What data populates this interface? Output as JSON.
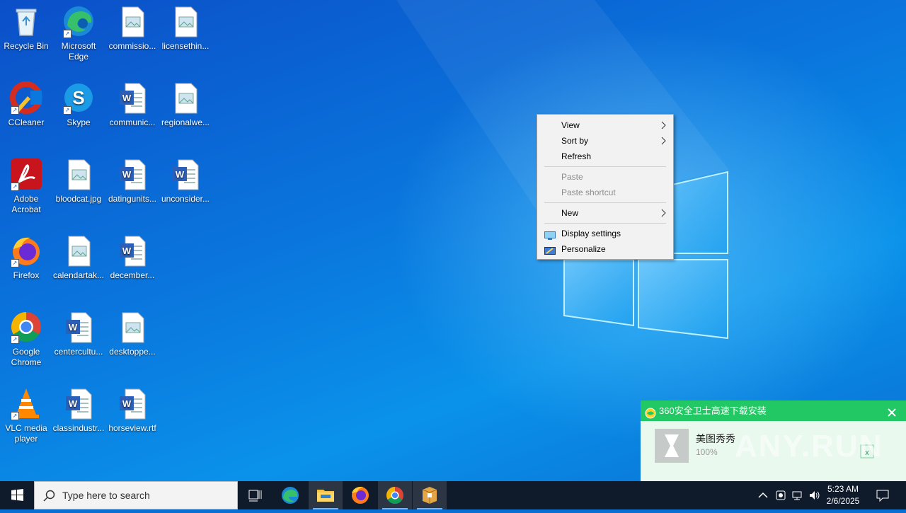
{
  "desktop": {
    "icons": [
      {
        "label": "Recycle Bin",
        "icon": "recycle-bin-icon"
      },
      {
        "label": "Microsoft Edge",
        "icon": "edge-icon"
      },
      {
        "label": "commissio...",
        "icon": "image-file-icon"
      },
      {
        "label": "licensethin...",
        "icon": "image-file-icon"
      },
      {
        "label": "CCleaner",
        "icon": "ccleaner-icon"
      },
      {
        "label": "Skype",
        "icon": "skype-icon"
      },
      {
        "label": "communic...",
        "icon": "word-file-icon"
      },
      {
        "label": "regionalwe...",
        "icon": "image-file-icon"
      },
      {
        "label": "Adobe Acrobat",
        "icon": "acrobat-icon"
      },
      {
        "label": "bloodcat.jpg",
        "icon": "image-file-icon"
      },
      {
        "label": "datingunits...",
        "icon": "word-file-icon"
      },
      {
        "label": "unconsider...",
        "icon": "word-file-icon"
      },
      {
        "label": "Firefox",
        "icon": "firefox-icon"
      },
      {
        "label": "calendartak...",
        "icon": "image-file-icon"
      },
      {
        "label": "december...",
        "icon": "word-file-icon"
      },
      {
        "label": "Google Chrome",
        "icon": "chrome-icon"
      },
      {
        "label": "centercultu...",
        "icon": "word-file-icon"
      },
      {
        "label": "desktoppe...",
        "icon": "image-file-icon"
      },
      {
        "label": "VLC media player",
        "icon": "vlc-icon"
      },
      {
        "label": "classindustr...",
        "icon": "word-file-icon"
      },
      {
        "label": "horseview.rtf",
        "icon": "word-file-icon"
      }
    ]
  },
  "context_menu": {
    "view": "View",
    "sort_by": "Sort by",
    "refresh": "Refresh",
    "paste": "Paste",
    "paste_shortcut": "Paste shortcut",
    "new": "New",
    "display_settings": "Display settings",
    "personalize": "Personalize"
  },
  "notification": {
    "title": "360安全卫士高速下载安装",
    "app_name": "美图秀秀",
    "progress": "100%"
  },
  "watermark": "ANY.RUN",
  "taskbar": {
    "search_placeholder": "Type here to search",
    "time": "5:23 AM",
    "date": "2/6/2025"
  },
  "colors": {
    "accent": "#0a78de",
    "notification_header": "#22c863",
    "taskbar": "#0f1a2b"
  }
}
